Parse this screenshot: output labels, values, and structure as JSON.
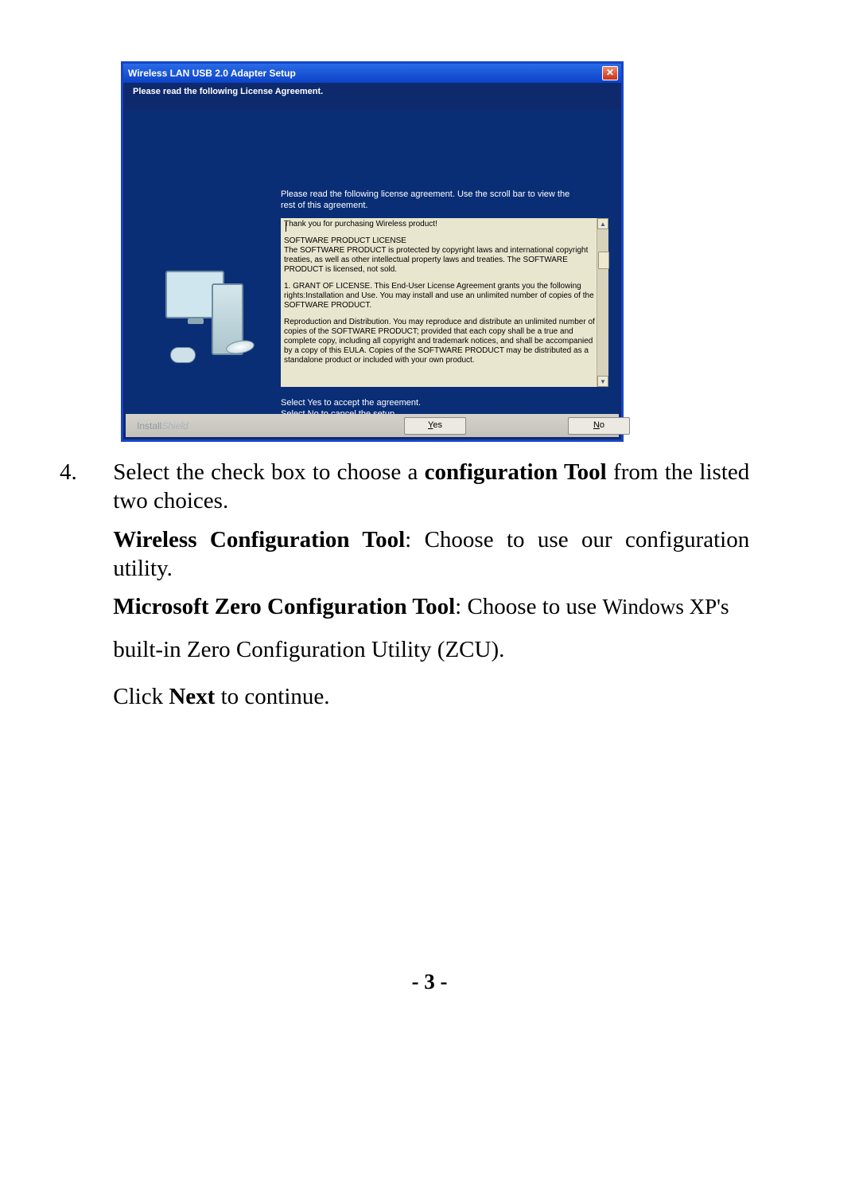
{
  "installer": {
    "title": "Wireless LAN USB 2.0 Adapter Setup",
    "subheader": "Please read the following License Agreement.",
    "lead": "Please read the following license agreement. Use the scroll bar to view the rest of this agreement.",
    "eula": {
      "p1": "Thank you for purchasing Wireless product!",
      "p2a": "SOFTWARE PRODUCT LICENSE",
      "p2b": "The SOFTWARE PRODUCT is protected by copyright laws and international copyright treaties, as well as other intellectual property laws and treaties. The SOFTWARE PRODUCT is licensed, not sold.",
      "p3": "1. GRANT OF LICENSE. This End-User License Agreement grants you the following rights:Installation and Use. You may install and use an unlimited number of copies of the SOFTWARE PRODUCT.",
      "p4": "Reproduction and Distribution. You may reproduce and distribute an unlimited number of copies of the SOFTWARE PRODUCT; provided that each copy shall be a true and complete copy, including all copyright and trademark notices, and shall be accompanied by a copy of this EULA. Copies of the SOFTWARE PRODUCT may be distributed as a standalone product or included with your own product."
    },
    "accept1": "Select Yes to accept the agreement.",
    "accept2": "Select No to cancel the setup.",
    "brand1": "Install",
    "brand2": "Shield",
    "yes_u": "Y",
    "yes_rest": "es",
    "no_u": "N",
    "no_rest": "o"
  },
  "doc": {
    "step_num": "4.",
    "step_a": "Select the check box to choose a ",
    "step_b": "configuration Tool",
    "step_c": " from the listed two choices.",
    "wct_a": "Wireless Configuration Tool",
    "wct_b": ": Choose to use our configuration utility.",
    "mzc_a": "Microsoft Zero Configuration Tool",
    "mzc_b": ": Choose to use ",
    "mzc_c": "Windows XP's",
    "zcu": "built-in Zero Configuration Utility (ZCU).",
    "next_a": "Click ",
    "next_b": "Next",
    "next_c": " to continue.",
    "page": "- 3 -"
  }
}
